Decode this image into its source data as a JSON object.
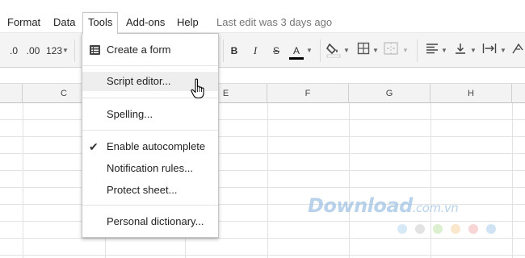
{
  "menubar": {
    "items": [
      "Format",
      "Data",
      "Tools",
      "Add-ons",
      "Help"
    ],
    "last_edit": "Last edit was 3 days ago"
  },
  "toolbar": {
    "decrease_decimal": ".0",
    "increase_decimal": ".00",
    "number_format": "123",
    "bold": "B",
    "italic": "I",
    "strike": "S",
    "text_color": "A"
  },
  "columns": [
    "C",
    "E",
    "F",
    "G",
    "H"
  ],
  "tools_menu": {
    "create_form": "Create a form",
    "script_editor": "Script editor...",
    "spelling": "Spelling...",
    "enable_autocomplete": "Enable autocomplete",
    "notification_rules": "Notification rules...",
    "protect_sheet": "Protect sheet...",
    "personal_dictionary": "Personal dictionary..."
  },
  "watermark": {
    "text": "Download",
    "suffix": ".com.vn"
  },
  "colors": {
    "accent": "#4a7dbd",
    "menu_hover": "#eeeeee",
    "watermark": "#9fc3e3"
  }
}
